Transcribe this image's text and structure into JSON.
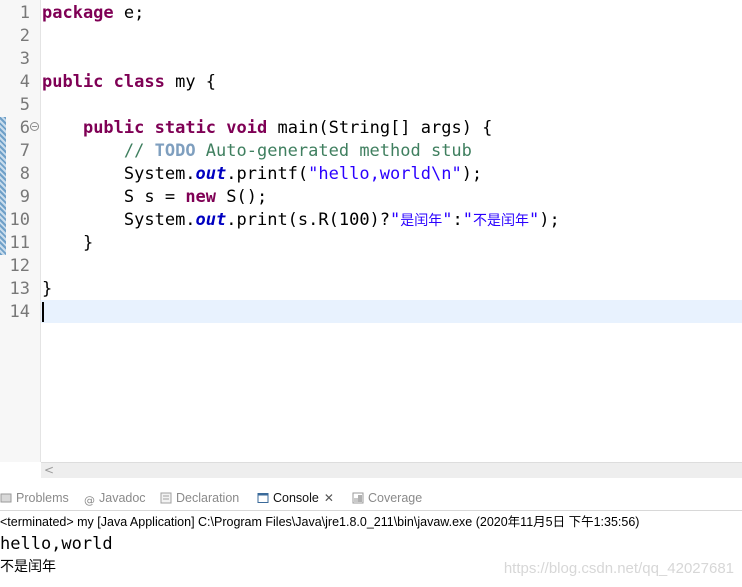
{
  "editor": {
    "line_numbers": [
      "1",
      "2",
      "3",
      "4",
      "5",
      "6",
      "7",
      "8",
      "9",
      "10",
      "11",
      "12",
      "13",
      "14"
    ],
    "line1": {
      "kw": "package",
      "rest": " e;"
    },
    "line4": {
      "kw1": "public",
      "sp": " ",
      "kw2": "class",
      "rest": " my {"
    },
    "line6": {
      "indent": "    ",
      "kw1": "public",
      "kw2": "static",
      "kw3": "void",
      "rest": " main(String[] args) {"
    },
    "line7": {
      "indent": "        ",
      "c1": "// ",
      "todo": "TODO",
      "c2": " Auto-generated method stub"
    },
    "line8": {
      "indent": "        ",
      "a": "System.",
      "field": "out",
      "b": ".printf(",
      "str": "\"hello,world\\n\"",
      "c": ");"
    },
    "line9": {
      "indent": "        ",
      "a": "S s = ",
      "kw": "new",
      "b": " S();"
    },
    "line10": {
      "indent": "        ",
      "a": "System.",
      "field": "out",
      "b": ".print(s.R(100)?",
      "q1": "\"",
      "cjk1": "是闰年",
      "q2": "\"",
      "colon": ":",
      "q3": "\"",
      "cjk2": "不是闰年",
      "q4": "\"",
      "c": ");"
    },
    "line11": "    }",
    "line13": "}"
  },
  "panel": {
    "tabs": [
      {
        "label": "Problems"
      },
      {
        "label": "Javadoc"
      },
      {
        "label": "Declaration"
      },
      {
        "label": "Console",
        "close": "✕"
      },
      {
        "label": "Coverage"
      }
    ],
    "status": "<terminated> my [Java Application] C:\\Program Files\\Java\\jre1.8.0_211\\bin\\javaw.exe (2020年11月5日 下午1:35:56)",
    "output_line1": "hello,world",
    "output_line2": "不是闰年"
  },
  "watermark": "https://blog.csdn.net/qq_42027681",
  "colors": {
    "keyword": "#7f0055",
    "comment": "#3f7f5f",
    "string": "#2a00ff",
    "field": "#0000c0",
    "current_line": "#e8f2fe"
  }
}
